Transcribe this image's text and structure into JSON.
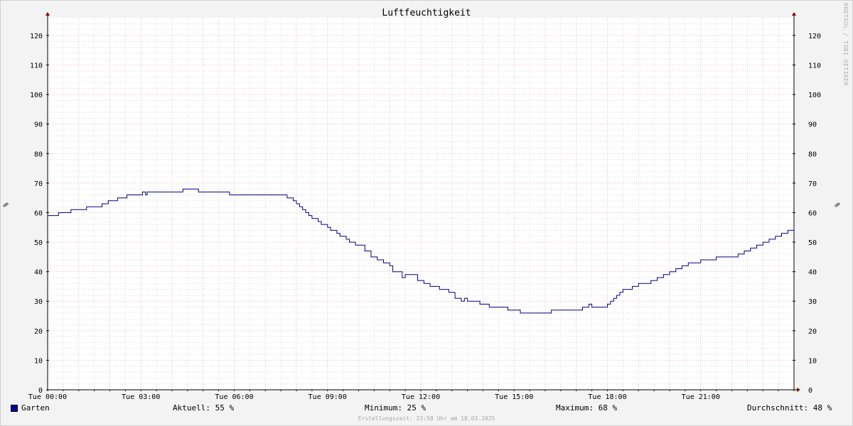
{
  "chart_data": {
    "type": "line",
    "title": "Luftfeuchtigkeit",
    "ylabel": "%",
    "xlim_hours": [
      0,
      24
    ],
    "ylim": [
      0,
      126
    ],
    "y_ticks": [
      0,
      10,
      20,
      30,
      40,
      50,
      60,
      70,
      80,
      90,
      100,
      110,
      120
    ],
    "x_ticks": [
      {
        "hour": 0,
        "label": "Tue 00:00"
      },
      {
        "hour": 3,
        "label": "Tue 03:00"
      },
      {
        "hour": 6,
        "label": "Tue 06:00"
      },
      {
        "hour": 9,
        "label": "Tue 09:00"
      },
      {
        "hour": 12,
        "label": "Tue 12:00"
      },
      {
        "hour": 15,
        "label": "Tue 15:00"
      },
      {
        "hour": 18,
        "label": "Tue 18:00"
      },
      {
        "hour": 21,
        "label": "Tue 21:00"
      }
    ],
    "grid": true,
    "legend_position": "bottom-left",
    "colors": {
      "line": "#000080",
      "major_grid": "#e8a0a8",
      "minor_grid": "#c8c8c8",
      "axis": "#000000",
      "arrow": "#8b0000",
      "background": "#ffffff"
    },
    "series": [
      {
        "name": "Garten",
        "x_hours": [
          0,
          0.3,
          0.35,
          0.7,
          0.75,
          1.2,
          1.25,
          1.7,
          1.75,
          1.9,
          1.95,
          2.2,
          2.25,
          2.5,
          2.55,
          2.95,
          3.05,
          3.15,
          3.2,
          4.3,
          4.35,
          4.8,
          4.85,
          5.8,
          5.85,
          7.6,
          7.7,
          7.8,
          7.9,
          8.0,
          8.1,
          8.2,
          8.3,
          8.4,
          8.5,
          8.7,
          8.8,
          9.0,
          9.1,
          9.3,
          9.4,
          9.6,
          9.7,
          9.9,
          10.0,
          10.2,
          10.4,
          10.6,
          10.8,
          11.0,
          11.1,
          11.2,
          11.4,
          11.5,
          11.9,
          12.0,
          12.1,
          12.2,
          12.3,
          12.6,
          12.9,
          13.0,
          13.1,
          13.3,
          13.4,
          13.5,
          13.7,
          13.9,
          14.0,
          14.2,
          14.6,
          14.8,
          15.0,
          15.2,
          16.1,
          16.2,
          17.1,
          17.2,
          17.4,
          17.5,
          17.9,
          18.0,
          18.1,
          18.2,
          18.3,
          18.4,
          18.5,
          18.6,
          18.8,
          19.0,
          19.2,
          19.4,
          19.6,
          19.8,
          20.0,
          20.2,
          20.4,
          20.6,
          20.8,
          21.0,
          21.5,
          22.0,
          22.2,
          22.4,
          22.6,
          22.8,
          23.0,
          23.2,
          23.4,
          23.6,
          23.8,
          24.0
        ],
        "y": [
          59,
          59,
          60,
          60,
          61,
          61,
          62,
          62,
          63,
          63,
          64,
          64,
          65,
          65,
          66,
          66,
          67,
          66,
          67,
          67,
          68,
          68,
          67,
          67,
          66,
          66,
          65,
          65,
          64,
          63,
          62,
          61,
          60,
          59,
          58,
          57,
          56,
          55,
          54,
          53,
          52,
          51,
          50,
          49,
          49,
          47,
          45,
          44,
          43,
          42,
          40,
          40,
          38,
          39,
          37,
          37,
          36,
          36,
          35,
          34,
          33,
          33,
          31,
          30,
          31,
          30,
          30,
          29,
          29,
          28,
          28,
          27,
          27,
          26,
          26,
          27,
          27,
          28,
          29,
          28,
          28,
          29,
          30,
          31,
          32,
          33,
          34,
          34,
          35,
          36,
          36,
          37,
          38,
          39,
          40,
          41,
          42,
          43,
          43,
          44,
          45,
          45,
          46,
          47,
          48,
          49,
          50,
          51,
          52,
          53,
          54,
          55
        ]
      }
    ]
  },
  "legend": {
    "series_name": "Garten",
    "current": "Aktuell:  55 %",
    "minimum": "Minimum:  25 %",
    "maximum": "Maximum:  68 %",
    "average": "Durchschnitt:  48 %"
  },
  "footer": "Erstellungszeit: 23:58 Uhr am 18.03.2025",
  "watermark": "RRDTOOL / TOBI OETIKER"
}
